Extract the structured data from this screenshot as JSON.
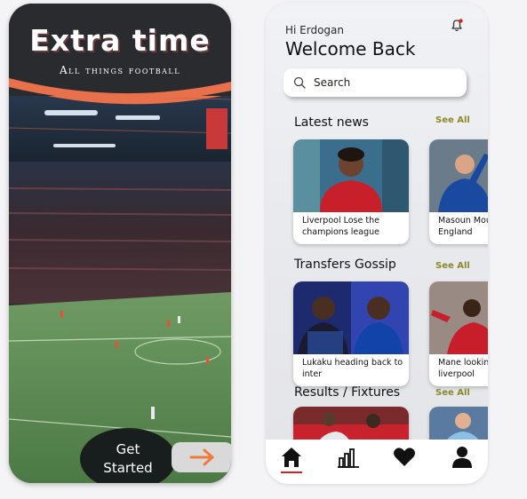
{
  "splash": {
    "title": "Extra time",
    "subtitle": "All things football",
    "get_started": "Get Started"
  },
  "home": {
    "greeting": "Hi Erdogan",
    "welcome": "Welcome Back",
    "search": {
      "placeholder": "Search"
    },
    "sections": [
      {
        "title": "Latest news",
        "see_all": "See All",
        "cards": [
          {
            "caption": "Liverpool Lose the champions league"
          },
          {
            "caption": "Masoun Mount for England"
          }
        ]
      },
      {
        "title": "Transfers Gossip",
        "see_all": "See All",
        "cards": [
          {
            "caption": "Lukaku heading back to inter"
          },
          {
            "caption": "Mane looking to leave liverpool"
          }
        ]
      },
      {
        "title": "Results / Fixtures",
        "see_all": "See All"
      }
    ],
    "nav": [
      "home-icon",
      "stats-icon",
      "heart-icon",
      "profile-icon"
    ]
  },
  "colors": {
    "accent_red": "#d42020",
    "see_all": "#8a8a2a",
    "splash_dark": "#2a2b2f",
    "arrow_orange": "#f07a3c"
  }
}
